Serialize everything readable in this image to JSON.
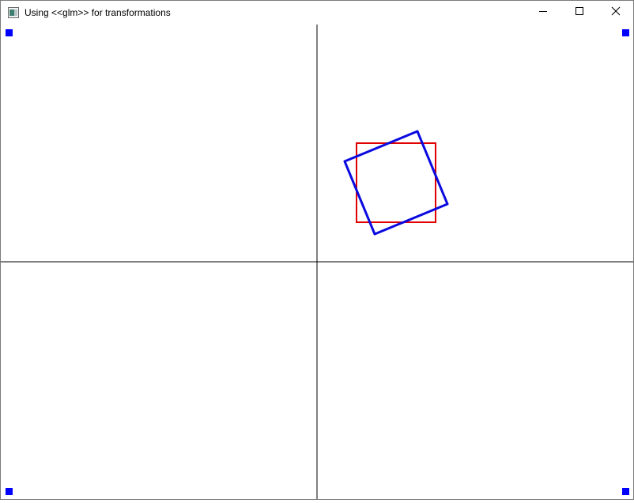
{
  "window": {
    "title": "Using <<glm>> for transformations"
  },
  "icons": {
    "app": "app-window-icon",
    "minimize": "minimize-icon",
    "maximize": "maximize-icon",
    "close": "close-icon"
  },
  "colors": {
    "axis_lines": "#000000",
    "red_square": "#e00000",
    "blue_square": "#0a0ae0",
    "corner_markers": "#0000ff"
  }
}
